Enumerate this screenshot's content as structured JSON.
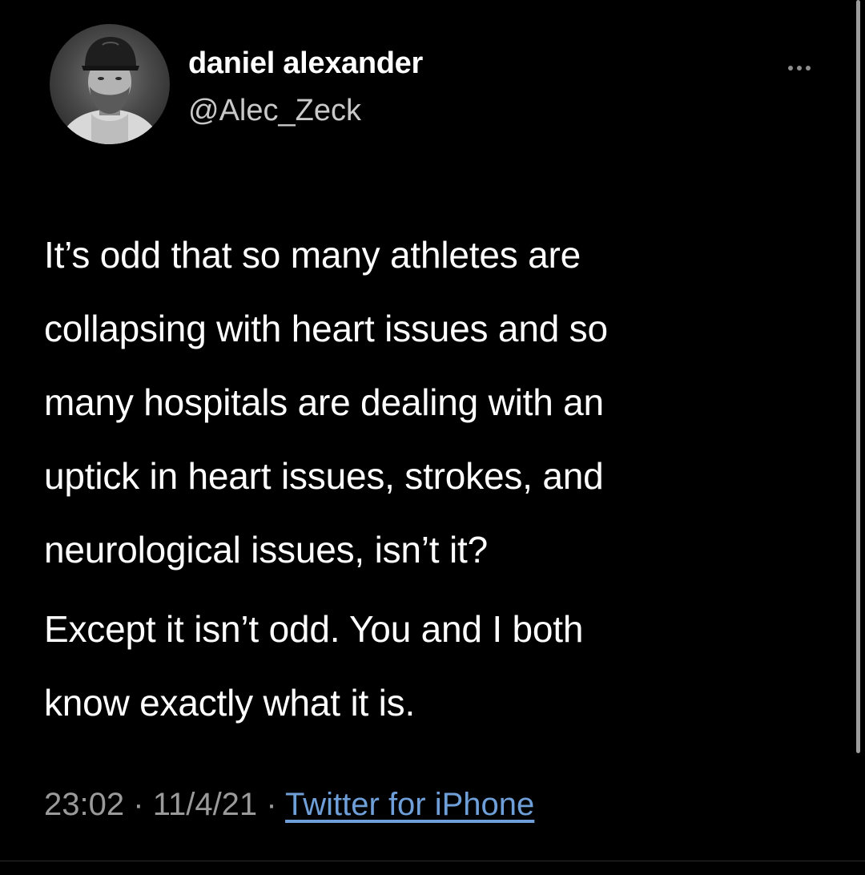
{
  "tweet": {
    "author": {
      "display_name": "daniel alexander",
      "handle": "@Alec_Zeck",
      "avatar_icon": "profile-photo"
    },
    "more_icon": "more-horizontal-icon",
    "body_lines": [
      "It’s odd that so many athletes are",
      "collapsing with heart issues and so",
      "many hospitals are dealing with an",
      "uptick in heart issues, strokes, and",
      "neurological issues, isn’t it?",
      "Except it isn’t odd. You and I both",
      "know exactly what it is."
    ],
    "meta": {
      "time": "23:02",
      "separator": "·",
      "date": "11/4/21",
      "source": "Twitter for iPhone"
    }
  },
  "colors": {
    "background": "#000000",
    "text": "#ffffff",
    "secondary_text": "#9a9a9a",
    "link": "#6f9fd8"
  }
}
